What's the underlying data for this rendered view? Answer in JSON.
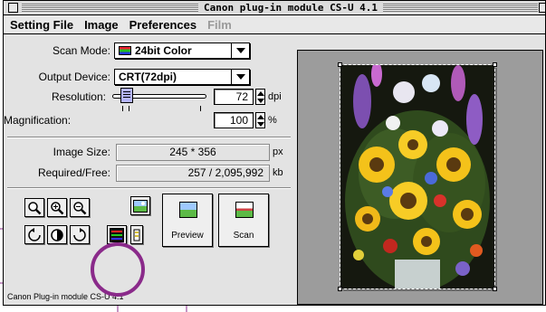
{
  "window": {
    "title": "Canon plug-in module CS-U 4.1"
  },
  "menu": [
    "Setting File",
    "Image",
    "Preferences",
    "Film"
  ],
  "scan_mode": {
    "label": "Scan Mode:",
    "value": "24bit Color"
  },
  "output_device": {
    "label": "Output Device:",
    "value": "CRT(72dpi)"
  },
  "resolution": {
    "label": "Resolution:",
    "value": "72",
    "unit": "dpi"
  },
  "magnification": {
    "label": "Magnification:",
    "value": "100",
    "unit": "%"
  },
  "image_size": {
    "label": "Image Size:",
    "value": "245 * 356",
    "unit": "px"
  },
  "required_free": {
    "label": "Required/Free:",
    "value": "257 / 2,095,992",
    "unit": "kb"
  },
  "buttons": {
    "preview": "Preview",
    "scan": "Scan"
  },
  "icons": {
    "zoom_fit": "magnifier-icon",
    "zoom_in": "magnifier-plus-icon",
    "zoom_out": "magnifier-minus-icon",
    "thumbnail": "picture-icon",
    "rotate_left": "rotate-left-icon",
    "invert": "half-circle-icon",
    "rotate_right": "rotate-right-icon",
    "color_adjust": "color-settings-icon",
    "eject": "eject-icon"
  },
  "status": "Canon Plug-in module CS-U 4.1",
  "colors": {
    "callout": "#8a2a8a",
    "preview_bg": "#9c9c9c",
    "window_bg": "#e3e3e3"
  }
}
